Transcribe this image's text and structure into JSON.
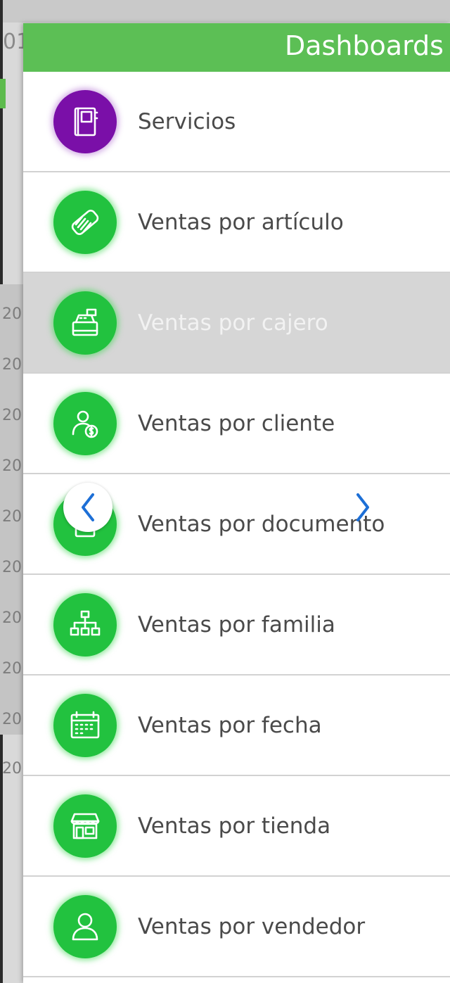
{
  "background": {
    "year_fragment": "01",
    "row_labels": [
      "20",
      "20",
      "20",
      "20",
      "20",
      "20",
      "20",
      "20",
      "20",
      "20"
    ]
  },
  "drawer": {
    "title": "Dashboards",
    "header_color": "#5cbf55",
    "items": [
      {
        "label": "Servicios",
        "icon": "book-icon",
        "color": "#7a0fa8",
        "active": false
      },
      {
        "label": "Ventas por artículo",
        "icon": "barcode-tag-icon",
        "color": "#22c23f",
        "active": false
      },
      {
        "label": "Ventas por cajero",
        "icon": "cash-register-icon",
        "color": "#22c23f",
        "active": true
      },
      {
        "label": "Ventas por cliente",
        "icon": "customer-money-icon",
        "color": "#22c23f",
        "active": false
      },
      {
        "label": "Ventas por documento",
        "icon": "document-icon",
        "color": "#22c23f",
        "active": false
      },
      {
        "label": "Ventas por familia",
        "icon": "hierarchy-icon",
        "color": "#22c23f",
        "active": false
      },
      {
        "label": "Ventas por fecha",
        "icon": "calendar-icon",
        "color": "#22c23f",
        "active": false
      },
      {
        "label": "Ventas por tienda",
        "icon": "store-icon",
        "color": "#22c23f",
        "active": false
      },
      {
        "label": "Ventas por vendedor",
        "icon": "person-icon",
        "color": "#22c23f",
        "active": false
      }
    ]
  },
  "nav": {
    "prev_icon": "chevron-left-icon",
    "next_icon": "chevron-right-icon",
    "arrow_color": "#1d6fd6"
  }
}
